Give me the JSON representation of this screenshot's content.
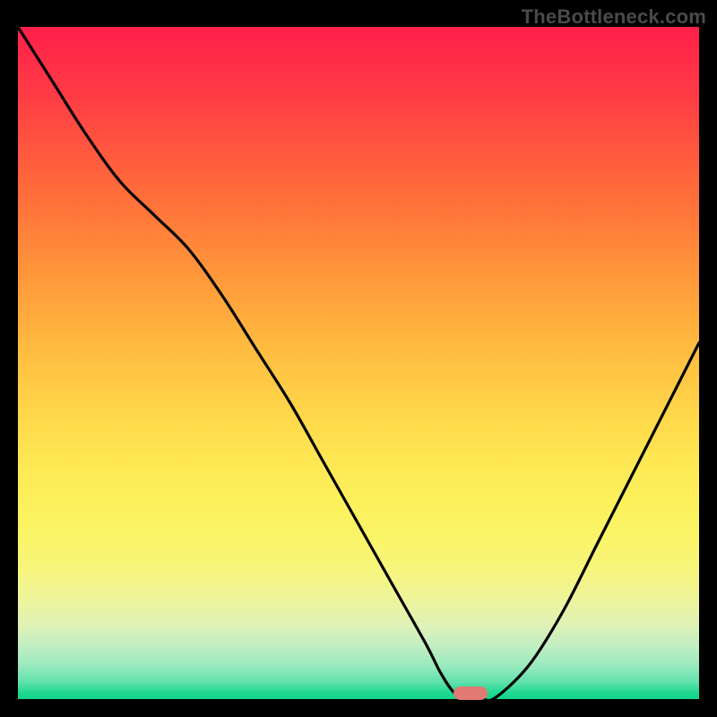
{
  "watermark": "TheBottleneck.com",
  "colors": {
    "background": "#000000",
    "gradient_top": "#ff1f4a",
    "gradient_bottom": "#0fd488",
    "curve": "#000000",
    "marker": "#e07a72",
    "watermark_text": "#4a4a4a"
  },
  "chart_data": {
    "type": "line",
    "title": "",
    "xlabel": "",
    "ylabel": "",
    "xlim": [
      0,
      100
    ],
    "ylim": [
      0,
      100
    ],
    "x": [
      0,
      5,
      10,
      15,
      20,
      25,
      30,
      35,
      40,
      45,
      50,
      55,
      60,
      62,
      64,
      66,
      68,
      70,
      75,
      80,
      85,
      90,
      95,
      100
    ],
    "values": [
      100,
      92,
      84,
      77,
      72,
      67,
      60,
      52,
      44,
      35,
      26,
      17,
      8,
      4,
      1,
      0,
      0,
      0,
      5,
      13,
      23,
      33,
      43,
      53
    ],
    "marker": {
      "x_center": 66.5,
      "width": 5,
      "y": 0
    },
    "gradient_stops": [
      {
        "pos": 0,
        "color": "#ff1f4a"
      },
      {
        "pos": 50,
        "color": "#ffd84a"
      },
      {
        "pos": 80,
        "color": "#faf56b"
      },
      {
        "pos": 100,
        "color": "#0fd488"
      }
    ]
  }
}
